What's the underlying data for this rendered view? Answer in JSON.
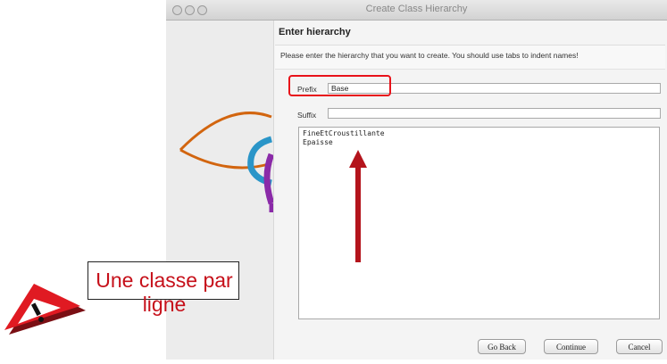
{
  "window": {
    "title": "Create Class Hierarchy"
  },
  "page": {
    "heading": "Enter hierarchy",
    "instructions": "Please enter the hierarchy that you want to create.  You should use tabs to indent names!"
  },
  "form": {
    "prefix_label": "Prefix",
    "prefix_value": "Base",
    "suffix_label": "Suffix",
    "suffix_value": "",
    "hierarchy_lines": [
      "FineEtCroustillante",
      "Epaisse"
    ]
  },
  "buttons": {
    "go_back": "Go Back",
    "continue": "Continue",
    "cancel": "Cancel"
  },
  "annotation": {
    "callout_text": "Une classe par ligne"
  },
  "colors": {
    "highlight": "#e8121a",
    "arrow": "#b4141c",
    "callout_text": "#c6101a"
  }
}
